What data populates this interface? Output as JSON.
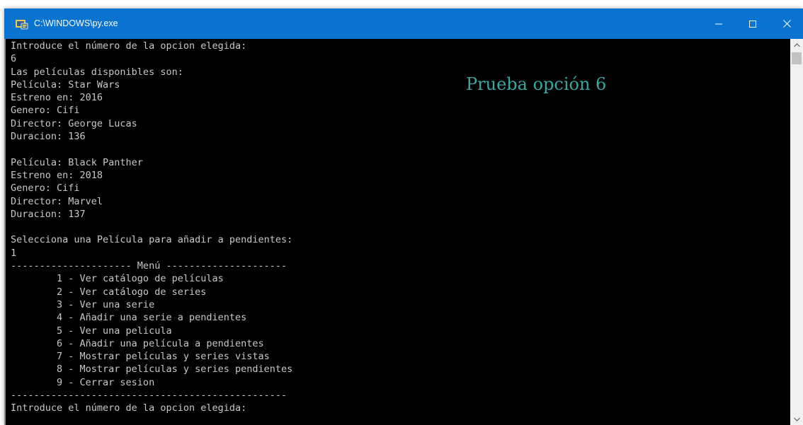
{
  "window": {
    "title": "C:\\WINDOWS\\py.exe",
    "icons": {
      "app": "python-launcher-icon",
      "minimize": "minimize-icon",
      "maximize": "maximize-icon",
      "close": "close-icon"
    },
    "colors": {
      "titlebar": "#0a73cf",
      "console_bg": "#000000",
      "console_text": "#c8c8c8",
      "caption": "#3aa7a0"
    }
  },
  "console": {
    "lines": [
      "Introduce el número de la opcion elegida:",
      "6",
      "Las películas disponibles son:",
      "Película: Star Wars",
      "Estreno en: 2016",
      "Genero: Cifi",
      "Director: George Lucas",
      "Duracion: 136",
      "",
      "Película: Black Panther",
      "Estreno en: 2018",
      "Genero: Cifi",
      "Director: Marvel",
      "Duracion: 137",
      "",
      "Selecciona una Película para añadir a pendientes:",
      "1",
      "--------------------- Menú ---------------------",
      "        1 - Ver catálogo de películas",
      "        2 - Ver catálogo de series",
      "        3 - Ver una serie",
      "        4 - Añadir una serie a pendientes",
      "        5 - Ver una pelicula",
      "        6 - Añadir una película a pendientes",
      "        7 - Mostrar películas y series vistas",
      "        8 - Mostrar películas y series pendientes",
      "        9 - Cerrar sesion",
      "------------------------------------------------",
      "Introduce el número de la opcion elegida:"
    ]
  },
  "overlay": {
    "caption": "Prueba opción 6"
  },
  "scrollbar": {
    "up_icon": "chevron-up-icon",
    "down_icon": "chevron-down-icon"
  }
}
